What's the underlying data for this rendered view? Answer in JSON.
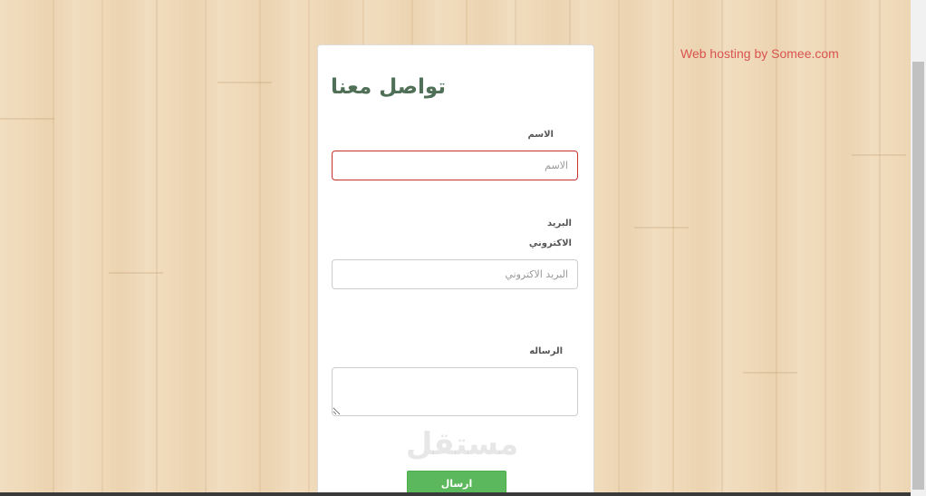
{
  "hosting": {
    "text": "Web hosting by Somee.com"
  },
  "form": {
    "title": "تواصل معنا",
    "name": {
      "label": "الاسم",
      "placeholder": "الاسم",
      "value": ""
    },
    "email": {
      "label_line1": "البريد",
      "label_line2": "الاكتروني",
      "placeholder": "البريد الاكتروني",
      "value": ""
    },
    "message": {
      "label": "الرساله",
      "value": ""
    },
    "submit_label": "ارسال"
  },
  "watermark": {
    "text": "مستقل"
  },
  "colors": {
    "accent_green": "#5cb85c",
    "title_green": "#4f6f56",
    "error_red": "#c9302c",
    "link_red": "#d9534f",
    "background_wood": "#efd9b8"
  }
}
